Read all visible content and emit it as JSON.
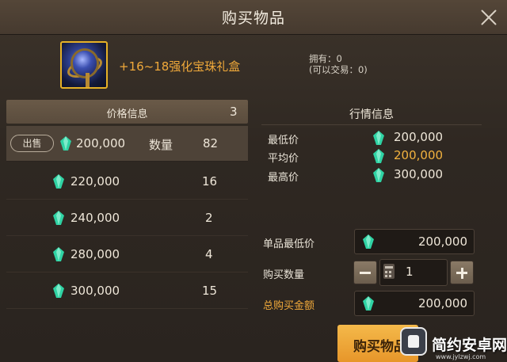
{
  "dialog": {
    "title": "购买物品",
    "close_icon": "close-icon"
  },
  "item": {
    "icon": "treasure-orb-icon",
    "name": "+16~18强化宝珠礼盒",
    "owned_line": "拥有：0",
    "tradable_line": "(可以交易：0)"
  },
  "price_panel": {
    "header": "价格信息",
    "count": "3",
    "sell_badge": "出售",
    "qty_label": "数量",
    "rows": [
      {
        "price": "200,000",
        "qty": "82"
      },
      {
        "price": "220,000",
        "qty": "16"
      },
      {
        "price": "240,000",
        "qty": "2"
      },
      {
        "price": "280,000",
        "qty": "4"
      },
      {
        "price": "300,000",
        "qty": "15"
      }
    ]
  },
  "market": {
    "title": "行情信息",
    "rows": [
      {
        "label": "最低价",
        "value": "200,000"
      },
      {
        "label": "平均价",
        "value": "200,000"
      },
      {
        "label": "最高价",
        "value": "300,000"
      }
    ]
  },
  "form": {
    "unit_min_label": "单品最低价",
    "unit_min_value": "200,000",
    "qty_label": "购买数量",
    "qty_value": "1",
    "total_label": "总购买金额",
    "total_value": "200,000"
  },
  "buy_button": "购买物品",
  "watermark": {
    "name": "简约安卓网",
    "url": "www.jylzwj.com"
  },
  "colors": {
    "accent_orange": "#f0a93a",
    "gem": "#2fd3a4",
    "buy_button": "#f0a93a"
  }
}
